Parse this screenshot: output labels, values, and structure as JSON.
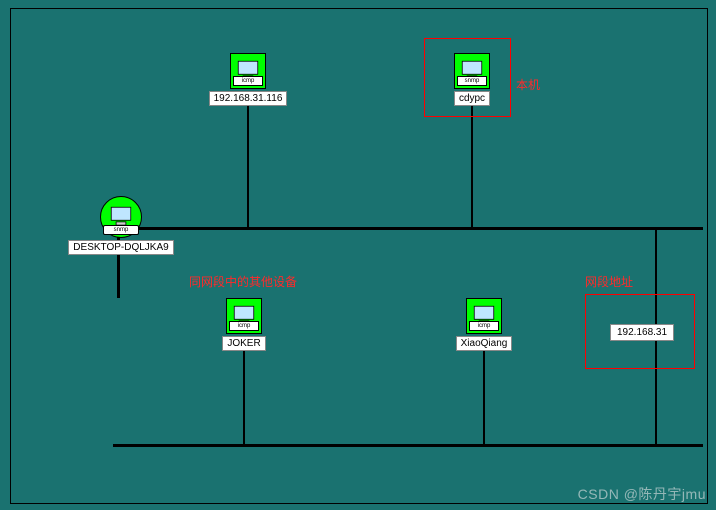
{
  "nodes": {
    "n1": {
      "label": "192.168.31.116",
      "badge": "icmp"
    },
    "n2": {
      "label": "cdypc",
      "badge": "snmp"
    },
    "root": {
      "label": "DESKTOP-DQLJKA9",
      "badge": "snmp"
    },
    "n3": {
      "label": "JOKER",
      "badge": "icmp"
    },
    "n4": {
      "label": "XiaoQiang",
      "badge": "icmp"
    }
  },
  "segment_chip": "192.168.31",
  "annotations": {
    "local_machine": "本机",
    "other_devices": "同网段中的其他设备",
    "segment_addr": "网段地址"
  },
  "watermark": "CSDN @陈丹宇jmu",
  "chart_data": {
    "type": "network-topology",
    "root": "DESKTOP-DQLJKA9",
    "upper_branch_nodes": [
      "192.168.31.116",
      "cdypc"
    ],
    "lower_branch_nodes": [
      "JOKER",
      "XiaoQiang"
    ],
    "segment": "192.168.31",
    "highlights": [
      {
        "target": "cdypc",
        "label": "本机"
      },
      {
        "target": [
          "JOKER",
          "XiaoQiang"
        ],
        "label": "同网段中的其他设备"
      },
      {
        "target": "192.168.31",
        "label": "网段地址"
      }
    ]
  }
}
